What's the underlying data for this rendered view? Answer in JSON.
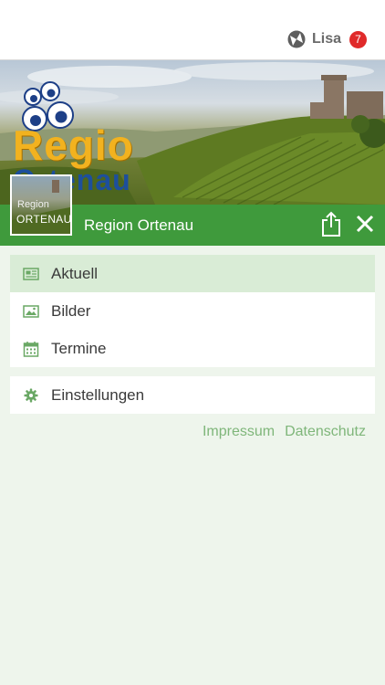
{
  "header": {
    "user_name": "Lisa",
    "notification_count": "7"
  },
  "hero": {
    "logo_line1": "Regio",
    "logo_line2": "Ortenau"
  },
  "thumbnail": {
    "line1": "Region",
    "line2": "ORTENAU"
  },
  "titlebar": {
    "title": "Region Ortenau"
  },
  "menu": {
    "items": [
      {
        "label": "Aktuell",
        "icon": "newspaper-icon",
        "active": true
      },
      {
        "label": "Bilder",
        "icon": "image-icon",
        "active": false
      },
      {
        "label": "Termine",
        "icon": "calendar-icon",
        "active": false
      }
    ],
    "settings_label": "Einstellungen"
  },
  "footer_links": {
    "impressum": "Impressum",
    "datenschutz": "Datenschutz"
  },
  "colors": {
    "accent_green": "#3f9a3c",
    "active_row": "#d9ecd6",
    "link_green": "#7fb67a",
    "badge_red": "#e02a2a",
    "background": "#eef5ec"
  }
}
